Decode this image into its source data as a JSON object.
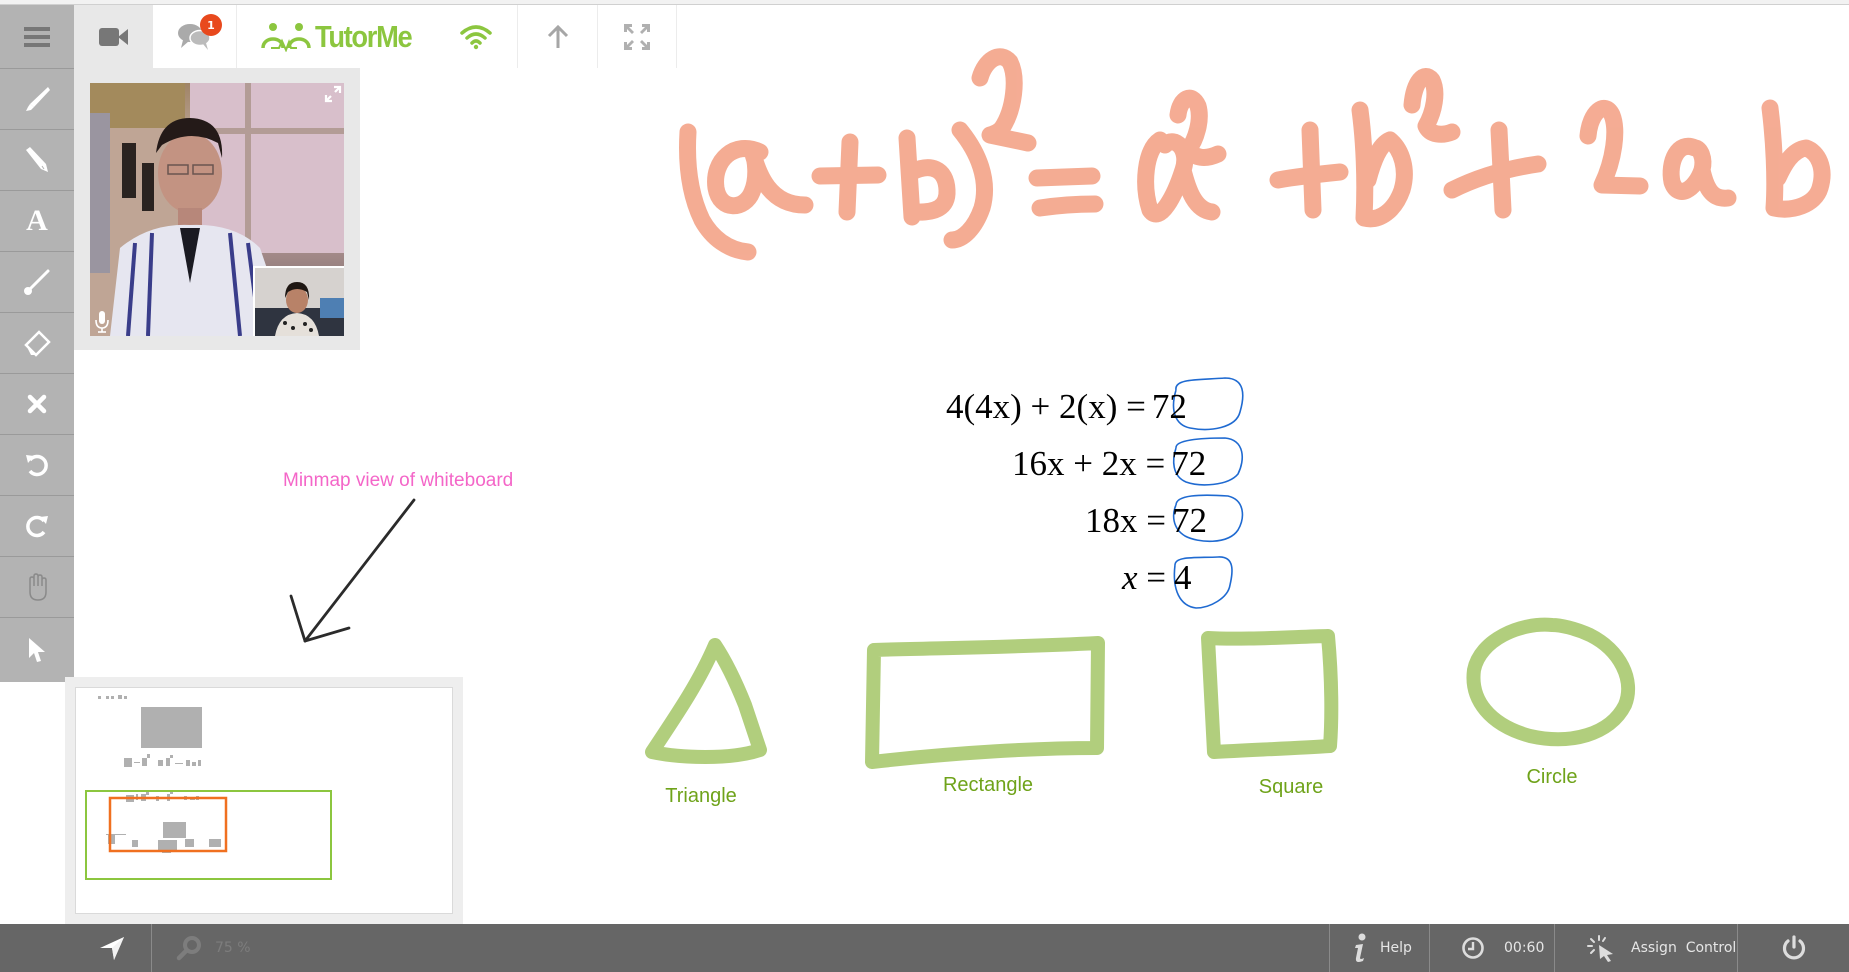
{
  "app": {
    "name": "TutorMe"
  },
  "colors": {
    "brand_green": "#8cc63f",
    "badge_red": "#e8491d",
    "handwriting": "#f4a88e",
    "shape_stroke": "#a9c96f",
    "shape_label": "#6fa31a",
    "annotation": "#f466c8",
    "minimap_viewport": "#8cc63f",
    "minimap_focus": "#f07020"
  },
  "topbar": {
    "items": [
      {
        "name": "video",
        "icon": "video-camera-icon"
      },
      {
        "name": "chat",
        "icon": "chat-bubbles-icon",
        "badge": "1"
      },
      {
        "name": "logo",
        "label": "TutorMe",
        "icon": "tutorme-logo-icon"
      },
      {
        "name": "connection",
        "icon": "wifi-signal-icon"
      },
      {
        "name": "upload",
        "icon": "arrow-up-icon"
      },
      {
        "name": "fullscreen",
        "icon": "fullscreen-icon"
      }
    ]
  },
  "sidebar": {
    "tools": [
      {
        "name": "menu",
        "icon": "hamburger-menu-icon"
      },
      {
        "name": "marker",
        "icon": "marker-icon"
      },
      {
        "name": "pencil",
        "icon": "pencil-icon"
      },
      {
        "name": "text",
        "icon": "text-tool-icon",
        "glyph": "A"
      },
      {
        "name": "line",
        "icon": "line-tool-icon"
      },
      {
        "name": "eraser",
        "icon": "eraser-icon"
      },
      {
        "name": "clear",
        "icon": "close-icon"
      },
      {
        "name": "undo",
        "icon": "undo-icon"
      },
      {
        "name": "redo",
        "icon": "redo-icon"
      },
      {
        "name": "pan",
        "icon": "hand-icon"
      },
      {
        "name": "select",
        "icon": "pointer-icon"
      }
    ]
  },
  "video": {
    "controls": {
      "expand_icon": "expand-icon",
      "mic_icon": "microphone-icon"
    }
  },
  "whiteboard": {
    "handwritten_formula": "(a+b)² = a² + b² + 2ab",
    "equations": [
      {
        "lhs": "4(4x) + 2(x)",
        "rhs": "72"
      },
      {
        "lhs": "16x + 2x",
        "rhs": "72"
      },
      {
        "lhs": "18x",
        "rhs": "72"
      },
      {
        "lhs": "x",
        "rhs": "4"
      }
    ],
    "annotation": "Minmap view of whiteboard",
    "shapes": [
      {
        "type": "triangle",
        "label": "Triangle"
      },
      {
        "type": "rectangle",
        "label": "Rectangle"
      },
      {
        "type": "square",
        "label": "Square"
      },
      {
        "type": "circle",
        "label": "Circle"
      }
    ]
  },
  "bottombar": {
    "zoom_level": "75 %",
    "help_label": "Help",
    "timer": "00:60",
    "assign_control_label": "Assign  Control"
  }
}
